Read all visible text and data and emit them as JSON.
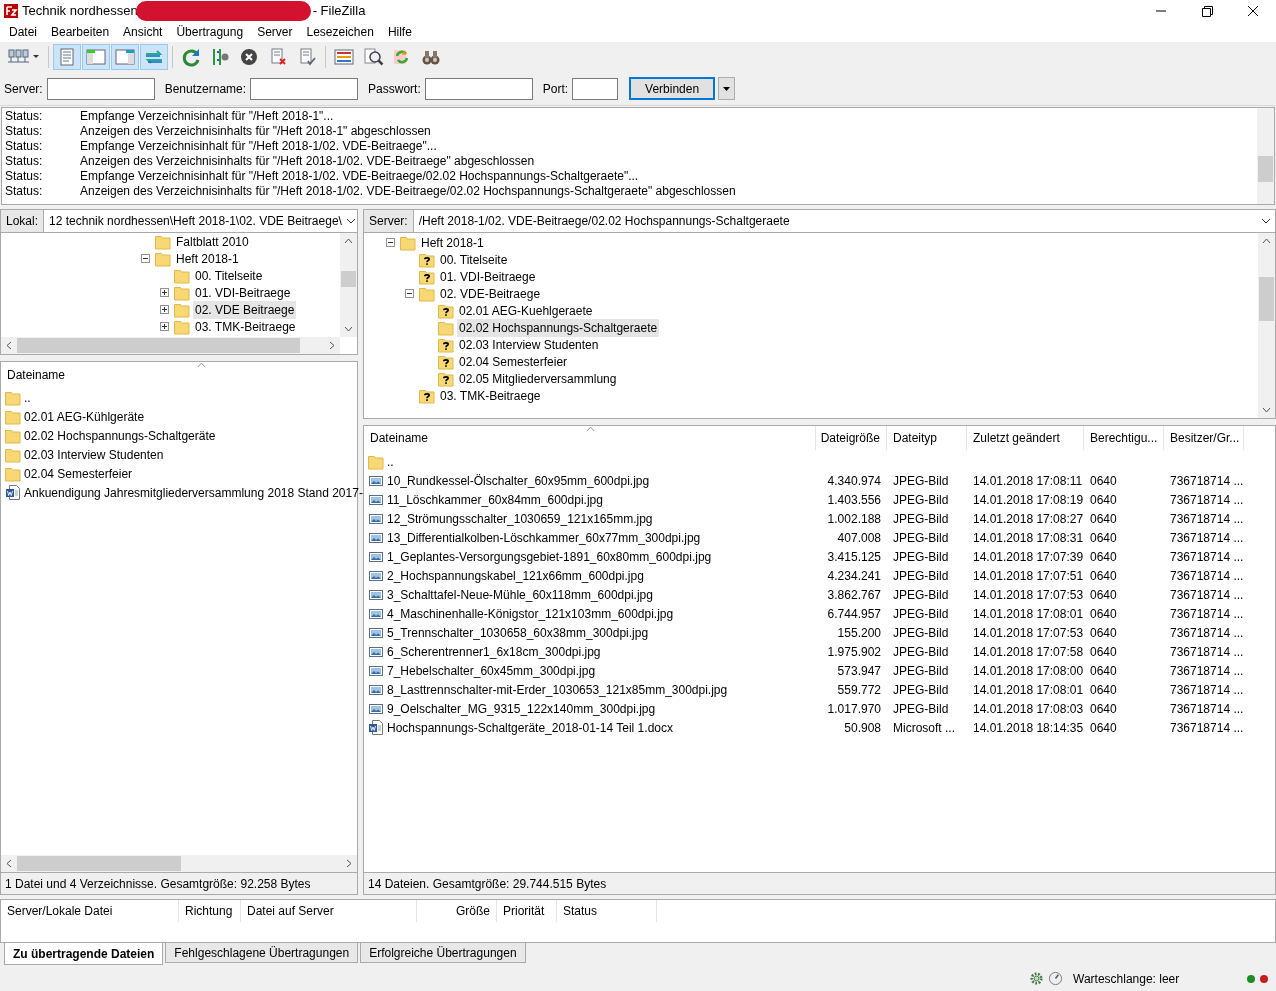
{
  "window": {
    "title_start": "Technik nordhessen",
    "title_end": "- FileZilla"
  },
  "menu": [
    "Datei",
    "Bearbeiten",
    "Ansicht",
    "Übertragung",
    "Server",
    "Lesezeichen",
    "Hilfe"
  ],
  "toolbar": [
    {
      "kind": "sites",
      "pressed": false
    },
    {
      "kind": "sep"
    },
    {
      "kind": "log",
      "pressed": true
    },
    {
      "kind": "localtree",
      "pressed": true
    },
    {
      "kind": "remotetree",
      "pressed": true
    },
    {
      "kind": "queue",
      "pressed": true
    },
    {
      "kind": "sep"
    },
    {
      "kind": "refresh",
      "pressed": false
    },
    {
      "kind": "filter",
      "pressed": false
    },
    {
      "kind": "cancel",
      "pressed": false
    },
    {
      "kind": "disconnect",
      "pressed": false
    },
    {
      "kind": "reconnect",
      "pressed": false
    },
    {
      "kind": "sep"
    },
    {
      "kind": "dirlist",
      "pressed": false
    },
    {
      "kind": "search",
      "pressed": false
    },
    {
      "kind": "sync",
      "pressed": false
    },
    {
      "kind": "find",
      "pressed": false
    }
  ],
  "quickconnect": {
    "fields": [
      {
        "label": "Server:"
      },
      {
        "label": "Benutzername:"
      },
      {
        "label": "Passwort:"
      },
      {
        "label": "Port:"
      }
    ],
    "button": "Verbinden"
  },
  "log": [
    {
      "label": "Status:",
      "message": "Empfange Verzeichnisinhalt für \"/Heft 2018-1\"..."
    },
    {
      "label": "Status:",
      "message": "Anzeigen des Verzeichnisinhalts für \"/Heft 2018-1\" abgeschlossen"
    },
    {
      "label": "Status:",
      "message": "Empfange Verzeichnisinhalt für \"/Heft 2018-1/02. VDE-Beitraege\"..."
    },
    {
      "label": "Status:",
      "message": "Anzeigen des Verzeichnisinhalts für \"/Heft 2018-1/02. VDE-Beitraege\" abgeschlossen"
    },
    {
      "label": "Status:",
      "message": "Empfange Verzeichnisinhalt für \"/Heft 2018-1/02. VDE-Beitraege/02.02 Hochspannungs-Schaltgeraete\"..."
    },
    {
      "label": "Status:",
      "message": "Anzeigen des Verzeichnisinhalts für \"/Heft 2018-1/02. VDE-Beitraege/02.02 Hochspannungs-Schaltgeraete\" abgeschlossen"
    }
  ],
  "local": {
    "path_label": "Lokal:",
    "path": "12  technik nordhessen\\Heft 2018-1\\02. VDE Beitraege\\",
    "tree": [
      {
        "name": "Faltblatt 2010",
        "kind": "folder",
        "selected": false
      },
      {
        "name": "Heft 2018-1",
        "kind": "folder",
        "selected": false,
        "expanded": true,
        "children": [
          {
            "name": "00. Titelseite",
            "kind": "folder",
            "selected": false
          },
          {
            "name": "01. VDI-Beitraege",
            "kind": "folder",
            "selected": false,
            "expanded": false
          },
          {
            "name": "02. VDE Beitraege",
            "kind": "folder",
            "selected": true,
            "expanded": false
          },
          {
            "name": "03. TMK-Beitraege",
            "kind": "folder",
            "selected": false,
            "expanded": false
          }
        ]
      }
    ],
    "columns": [
      "Dateiname"
    ],
    "files": [
      {
        "name": "..",
        "kind": "folder"
      },
      {
        "name": "02.01 AEG-Kühlgeräte",
        "kind": "folder"
      },
      {
        "name": "02.02 Hochspannungs-Schaltgeräte",
        "kind": "folder"
      },
      {
        "name": "02.03 Interview Studenten",
        "kind": "folder"
      },
      {
        "name": "02.04 Semesterfeier",
        "kind": "folder"
      },
      {
        "name": "Ankuendigung Jahresmitgliederversammlung 2018 Stand 2017-",
        "kind": "doc"
      }
    ],
    "status": "1 Datei und 4 Verzeichnisse. Gesamtgröße: 92.258 Bytes"
  },
  "remote": {
    "path_label": "Server:",
    "path": "/Heft 2018-1/02. VDE-Beitraege/02.02 Hochspannungs-Schaltgeraete",
    "tree": [
      {
        "name": "Heft 2018-1",
        "kind": "folder",
        "selected": false,
        "expanded": true,
        "children": [
          {
            "name": "00. Titelseite",
            "kind": "unknown",
            "selected": false
          },
          {
            "name": "01. VDI-Beitraege",
            "kind": "unknown",
            "selected": false
          },
          {
            "name": "02. VDE-Beitraege",
            "kind": "folder",
            "selected": false,
            "expanded": true,
            "children": [
              {
                "name": "02.01 AEG-Kuehlgeraete",
                "kind": "unknown",
                "selected": false
              },
              {
                "name": "02.02 Hochspannungs-Schaltgeraete",
                "kind": "folder",
                "selected": true
              },
              {
                "name": "02.03 Interview Studenten",
                "kind": "unknown",
                "selected": false
              },
              {
                "name": "02.04 Semesterfeier",
                "kind": "unknown",
                "selected": false
              },
              {
                "name": "02.05 Mitgliederversammlung",
                "kind": "unknown",
                "selected": false
              }
            ]
          },
          {
            "name": "03. TMK-Beitraege",
            "kind": "unknown",
            "selected": false
          }
        ]
      }
    ],
    "columns": [
      "Dateiname",
      "Dateigröße",
      "Dateityp",
      "Zuletzt geändert",
      "Berechtigu...",
      "Besitzer/Gr..."
    ],
    "files": [
      {
        "kind": "folder",
        "cells": [
          ".."
        ]
      },
      {
        "kind": "image",
        "cells": [
          "10_Rundkessel-Ölschalter_60x95mm_600dpi.jpg",
          "4.340.974",
          "JPEG-Bild",
          "14.01.2018 17:08:11",
          "0640",
          "736718714 ..."
        ]
      },
      {
        "kind": "image",
        "cells": [
          "11_Löschkammer_60x84mm_600dpi.jpg",
          "1.403.556",
          "JPEG-Bild",
          "14.01.2018 17:08:19",
          "0640",
          "736718714 ..."
        ]
      },
      {
        "kind": "image",
        "cells": [
          "12_Strömungsschalter_1030659_121x165mm.jpg",
          "1.002.188",
          "JPEG-Bild",
          "14.01.2018 17:08:27",
          "0640",
          "736718714 ..."
        ]
      },
      {
        "kind": "image",
        "cells": [
          "13_Differentialkolben-Löschkammer_60x77mm_300dpi.jpg",
          "407.008",
          "JPEG-Bild",
          "14.01.2018 17:08:31",
          "0640",
          "736718714 ..."
        ]
      },
      {
        "kind": "image",
        "cells": [
          "1_Geplantes-Versorgungsgebiet-1891_60x80mm_600dpi.jpg",
          "3.415.125",
          "JPEG-Bild",
          "14.01.2018 17:07:39",
          "0640",
          "736718714 ..."
        ]
      },
      {
        "kind": "image",
        "cells": [
          "2_Hochspannungskabel_121x66mm_600dpi.jpg",
          "4.234.241",
          "JPEG-Bild",
          "14.01.2018 17:07:51",
          "0640",
          "736718714 ..."
        ]
      },
      {
        "kind": "image",
        "cells": [
          "3_Schalttafel-Neue-Mühle_60x118mm_600dpi.jpg",
          "3.862.767",
          "JPEG-Bild",
          "14.01.2018 17:07:53",
          "0640",
          "736718714 ..."
        ]
      },
      {
        "kind": "image",
        "cells": [
          "4_Maschinenhalle-Königstor_121x103mm_600dpi.jpg",
          "6.744.957",
          "JPEG-Bild",
          "14.01.2018 17:08:01",
          "0640",
          "736718714 ..."
        ]
      },
      {
        "kind": "image",
        "cells": [
          "5_Trennschalter_1030658_60x38mm_300dpi.jpg",
          "155.200",
          "JPEG-Bild",
          "14.01.2018 17:07:53",
          "0640",
          "736718714 ..."
        ]
      },
      {
        "kind": "image",
        "cells": [
          "6_Scherentrenner1_6x18cm_300dpi.jpg",
          "1.975.902",
          "JPEG-Bild",
          "14.01.2018 17:07:58",
          "0640",
          "736718714 ..."
        ]
      },
      {
        "kind": "image",
        "cells": [
          "7_Hebelschalter_60x45mm_300dpi.jpg",
          "573.947",
          "JPEG-Bild",
          "14.01.2018 17:08:00",
          "0640",
          "736718714 ..."
        ]
      },
      {
        "kind": "image",
        "cells": [
          "8_Lasttrennschalter-mit-Erder_1030653_121x85mm_300dpi.jpg",
          "559.772",
          "JPEG-Bild",
          "14.01.2018 17:08:01",
          "0640",
          "736718714 ..."
        ]
      },
      {
        "kind": "image",
        "cells": [
          "9_Oelschalter_MG_9315_122x140mm_300dpi.jpg",
          "1.017.970",
          "JPEG-Bild",
          "14.01.2018 17:08:03",
          "0640",
          "736718714 ..."
        ]
      },
      {
        "kind": "doc",
        "cells": [
          "Hochspannungs-Schaltgeräte_2018-01-14 Teil 1.docx",
          "50.908",
          "Microsoft ...",
          "14.01.2018 18:14:35",
          "0640",
          "736718714 ..."
        ]
      }
    ],
    "status": "14 Dateien. Gesamtgröße: 29.744.515 Bytes"
  },
  "queue": {
    "columns": [
      "Server/Lokale Datei",
      "Richtung",
      "Datei auf Server",
      "Größe",
      "Priorität",
      "Status"
    ]
  },
  "tabs": [
    {
      "label": "Zu übertragende Dateien",
      "selected": true
    },
    {
      "label": "Fehlgeschlagene Übertragungen",
      "selected": false
    },
    {
      "label": "Erfolgreiche Übertragungen",
      "selected": false
    }
  ],
  "status_bar": {
    "queue": "Warteschlange: leer",
    "lights": [
      {
        "color": "#1e8c1e"
      },
      {
        "color": "#c81e1e"
      }
    ]
  }
}
